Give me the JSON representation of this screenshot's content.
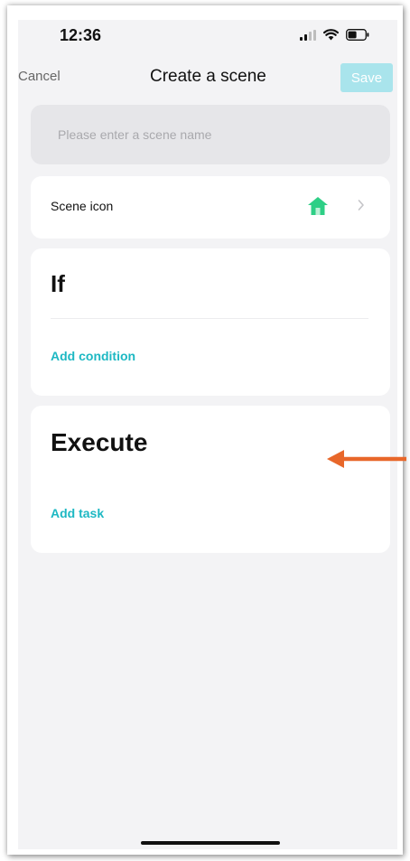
{
  "status_bar": {
    "time": "12:36"
  },
  "nav": {
    "cancel_label": "Cancel",
    "title": "Create a scene",
    "save_label": "Save"
  },
  "scene_name": {
    "placeholder": "Please enter a scene name",
    "value": ""
  },
  "scene_icon": {
    "label": "Scene icon",
    "icon": "house-icon"
  },
  "if_section": {
    "title": "If",
    "add_label": "Add condition"
  },
  "execute_section": {
    "title": "Execute",
    "add_label": "Add task"
  },
  "colors": {
    "accent": "#1db8c3",
    "save_disabled_bg": "#a9e4ec",
    "house_icon": "#2ecf86",
    "annotation_arrow": "#e8672a",
    "screen_bg": "#f3f3f5",
    "card_bg": "#ffffff"
  }
}
